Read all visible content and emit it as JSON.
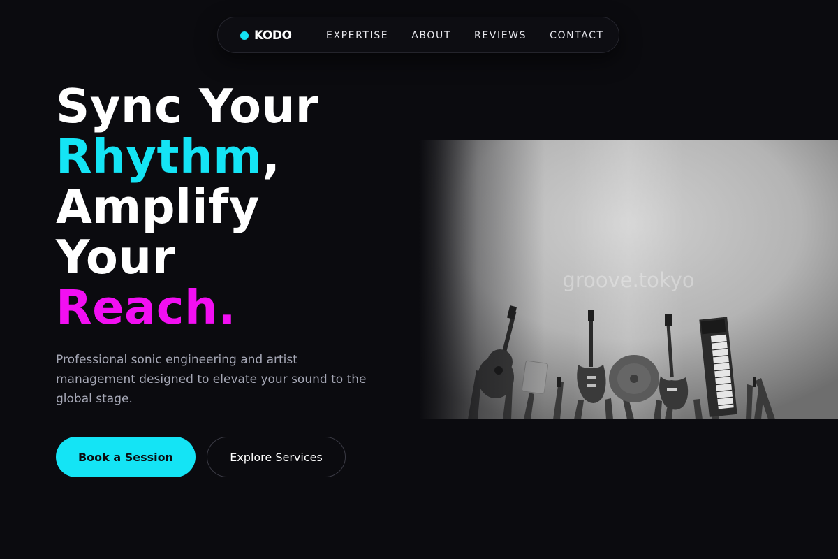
{
  "nav": {
    "brand": "KODO",
    "links": [
      {
        "label": "EXPERTISE"
      },
      {
        "label": "ABOUT"
      },
      {
        "label": "REVIEWS"
      },
      {
        "label": "CONTACT"
      }
    ]
  },
  "hero": {
    "title": {
      "line1": "Sync Your",
      "word_rhythm": "Rhythm",
      "comma": ",",
      "line3": "Amplify",
      "line4": "Your",
      "word_reach": "Reach."
    },
    "subtitle": "Professional sonic engineering and artist management designed to elevate your sound to the global stage.",
    "primary_button": "Book a Session",
    "secondary_button": "Explore Services"
  },
  "image": {
    "watermark": "groove.tokyo",
    "subject": "hands raising guitars, a cymbal and a keyboard against a bright grey backdrop"
  },
  "colors": {
    "background": "#0b0b0f",
    "accent_cyan": "#14e4f5",
    "accent_magenta": "#f20ff2",
    "text_muted": "#a6a8b6"
  }
}
